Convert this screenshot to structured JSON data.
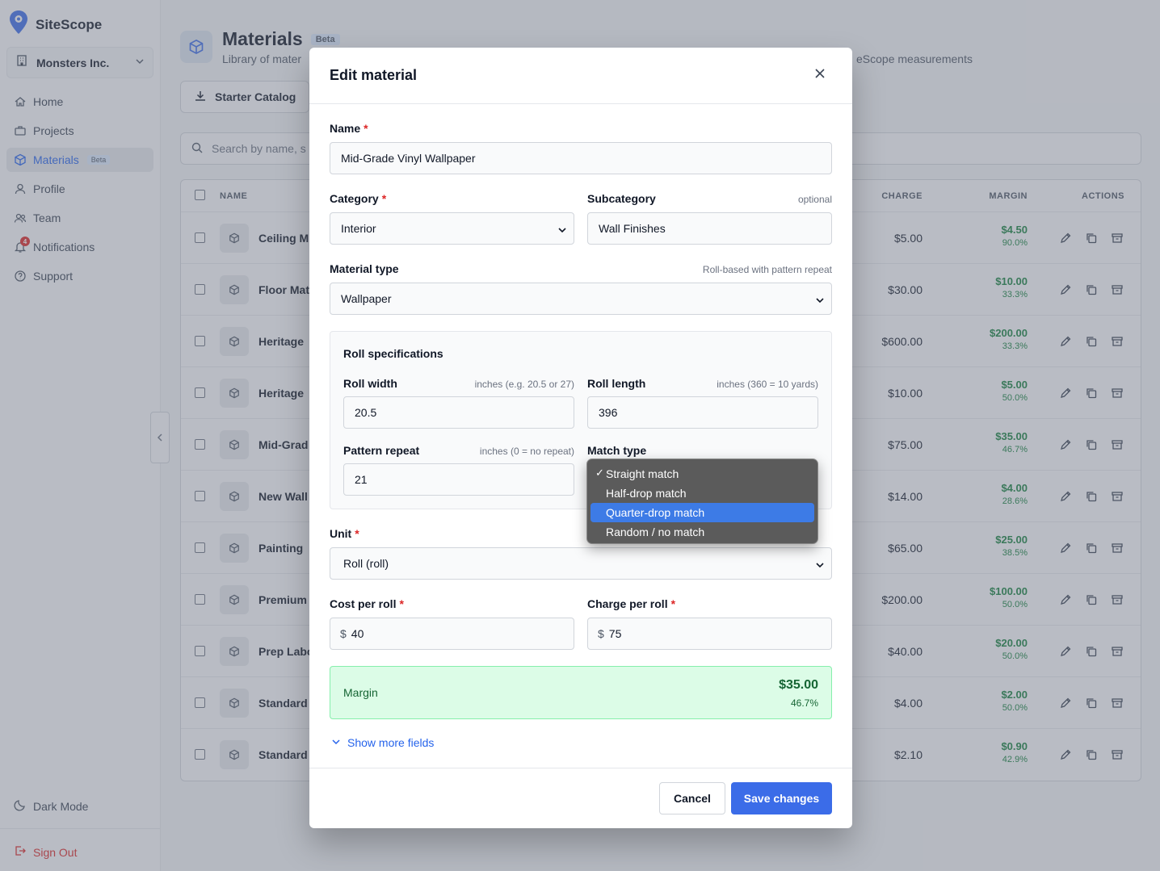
{
  "app": {
    "name": "SiteScope"
  },
  "org": {
    "name": "Monsters Inc."
  },
  "nav": [
    {
      "label": "Home",
      "icon": "home-icon"
    },
    {
      "label": "Projects",
      "icon": "briefcase-icon"
    },
    {
      "label": "Materials",
      "icon": "cube-icon",
      "badge": "Beta",
      "active": true
    },
    {
      "label": "Profile",
      "icon": "user-icon"
    },
    {
      "label": "Team",
      "icon": "users-icon"
    },
    {
      "label": "Notifications",
      "icon": "bell-icon",
      "count": "4"
    },
    {
      "label": "Support",
      "icon": "help-icon"
    }
  ],
  "sidebar_footer": {
    "dark_mode": "Dark Mode",
    "sign_out": "Sign Out"
  },
  "page": {
    "title": "Materials",
    "badge": "Beta",
    "subtitle_left": "Library of mater",
    "subtitle_right": "eScope measurements",
    "starter_label": "Starter Catalog",
    "search_placeholder": "Search by name, s"
  },
  "table": {
    "headers": {
      "name": "NAME",
      "charge": "CHARGE",
      "margin": "MARGIN",
      "actions": "ACTIONS"
    },
    "rows": [
      {
        "name": "Ceiling M",
        "charge": "$5.00",
        "margin": "$4.50",
        "pct": "90.0%"
      },
      {
        "name": "Floor Mat",
        "charge": "$30.00",
        "margin": "$10.00",
        "pct": "33.3%"
      },
      {
        "name": "Heritage",
        "charge": "$600.00",
        "margin": "$200.00",
        "pct": "33.3%"
      },
      {
        "name": "Heritage",
        "charge": "$10.00",
        "margin": "$5.00",
        "pct": "50.0%"
      },
      {
        "name": "Mid-Grad",
        "charge": "$75.00",
        "margin": "$35.00",
        "pct": "46.7%"
      },
      {
        "name": "New Wall",
        "charge": "$14.00",
        "margin": "$4.00",
        "pct": "28.6%"
      },
      {
        "name": "Painting",
        "charge": "$65.00",
        "margin": "$25.00",
        "pct": "38.5%"
      },
      {
        "name": "Premium",
        "charge": "$200.00",
        "margin": "$100.00",
        "pct": "50.0%"
      },
      {
        "name": "Prep Labo",
        "charge": "$40.00",
        "margin": "$20.00",
        "pct": "50.0%"
      },
      {
        "name": "Standard",
        "charge": "$4.00",
        "margin": "$2.00",
        "pct": "50.0%"
      },
      {
        "name": "Standard",
        "charge": "$2.10",
        "margin": "$0.90",
        "pct": "42.9%"
      }
    ]
  },
  "modal": {
    "title": "Edit material",
    "name": {
      "label": "Name",
      "value": "Mid-Grade Vinyl Wallpaper"
    },
    "category": {
      "label": "Category",
      "value": "Interior"
    },
    "subcategory": {
      "label": "Subcategory",
      "hint": "optional",
      "value": "Wall Finishes"
    },
    "material_type": {
      "label": "Material type",
      "hint": "Roll-based with pattern repeat",
      "value": "Wallpaper"
    },
    "roll": {
      "title": "Roll specifications",
      "width": {
        "label": "Roll width",
        "hint": "inches (e.g. 20.5 or 27)",
        "value": "20.5"
      },
      "length": {
        "label": "Roll length",
        "hint": "inches (360 = 10 yards)",
        "value": "396"
      },
      "repeat": {
        "label": "Pattern repeat",
        "hint": "inches (0 = no repeat)",
        "value": "21"
      },
      "match": {
        "label": "Match type"
      }
    },
    "unit": {
      "label": "Unit",
      "value": "Roll (roll)"
    },
    "cost": {
      "label": "Cost per roll",
      "prefix": "$",
      "value": "40"
    },
    "charge": {
      "label": "Charge per roll",
      "prefix": "$",
      "value": "75"
    },
    "margin": {
      "label": "Margin",
      "amount": "$35.00",
      "pct": "46.7%"
    },
    "show_more": "Show more fields",
    "cancel": "Cancel",
    "save": "Save changes"
  },
  "match_dropdown": {
    "options": [
      "Straight match",
      "Half-drop match",
      "Quarter-drop match",
      "Random / no match"
    ],
    "checked": "Straight match",
    "highlighted": "Quarter-drop match"
  },
  "colors": {
    "accent": "#3b6ce8",
    "margin_green": "#15803d",
    "danger": "#dc2626"
  }
}
